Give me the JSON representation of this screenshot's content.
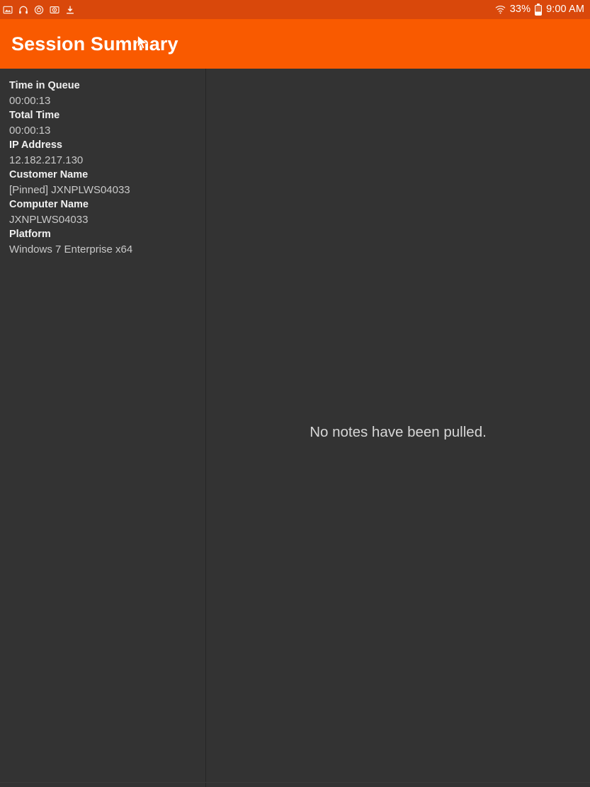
{
  "status_bar": {
    "left_icons": [
      {
        "name": "image-icon",
        "label": "image"
      },
      {
        "name": "headphones-icon",
        "label": "headphones"
      },
      {
        "name": "power-circle-icon",
        "label": "power"
      },
      {
        "name": "camera-icon",
        "label": "camera"
      },
      {
        "name": "download-icon",
        "label": "download"
      }
    ],
    "wifi_icon": "wifi-icon",
    "battery_percent": "33%",
    "battery_icon": "battery-icon",
    "clock": "9:00 AM"
  },
  "app_bar": {
    "title": "Session Summary",
    "cursor": "mouse-pointer-icon"
  },
  "sidebar": {
    "fields": [
      {
        "label": "Time in Queue",
        "value": "00:00:13"
      },
      {
        "label": "Total Time",
        "value": "00:00:13"
      },
      {
        "label": "IP Address",
        "value": "12.182.217.130"
      },
      {
        "label": "Customer Name",
        "value": "[Pinned] JXNPLWS04033"
      },
      {
        "label": "Computer Name",
        "value": "JXNPLWS04033"
      },
      {
        "label": "Platform",
        "value": "Windows 7 Enterprise x64"
      }
    ]
  },
  "notes_pane": {
    "empty_message": "No notes have been pulled."
  },
  "colors": {
    "accent_orange": "#f95a00",
    "status_bar_orange": "#d9480b",
    "background_dark": "#333333",
    "divider": "#262626",
    "label_text": "#f0f0f0",
    "value_text": "#c9c9c9"
  }
}
